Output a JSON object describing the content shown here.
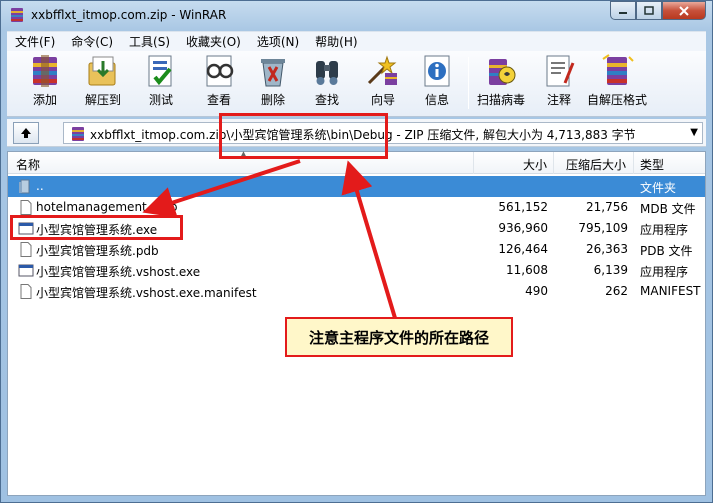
{
  "window": {
    "title": "xxbfflxt_itmop.com.zip - WinRAR"
  },
  "menu": [
    "文件(F)",
    "命令(C)",
    "工具(S)",
    "收藏夹(O)",
    "选项(N)",
    "帮助(H)"
  ],
  "toolbar": {
    "buttons": [
      {
        "label": "添加",
        "icon": "add-archive-icon"
      },
      {
        "label": "解压到",
        "icon": "extract-to-icon"
      },
      {
        "label": "测试",
        "icon": "test-icon"
      },
      {
        "label": "查看",
        "icon": "view-icon"
      },
      {
        "label": "删除",
        "icon": "delete-icon"
      },
      {
        "label": "查找",
        "icon": "find-icon"
      },
      {
        "label": "向导",
        "icon": "wizard-icon"
      },
      {
        "label": "信息",
        "icon": "info-icon"
      },
      {
        "label": "扫描病毒",
        "icon": "virus-scan-icon"
      },
      {
        "label": "注释",
        "icon": "comment-icon"
      },
      {
        "label": "自解压格式",
        "icon": "sfx-icon"
      }
    ]
  },
  "address": {
    "path_prefix": "xxbfflxt_itmop.com.zip\\小型宾馆管理系统\\bin\\Debug",
    "path_suffix": " - ZIP 压缩文件, 解包大小为 4,713,883 字节"
  },
  "columns": {
    "name": "名称",
    "size": "大小",
    "packed": "压缩后大小",
    "type": "类型"
  },
  "files": [
    {
      "name": "..",
      "size": "",
      "packed": "",
      "type": "文件夹",
      "icon": "folder-icon",
      "selected": true
    },
    {
      "name": "hotelmanagement.mdb",
      "size": "561,152",
      "packed": "21,756",
      "type": "MDB 文件",
      "icon": "file-icon",
      "selected": false
    },
    {
      "name": "小型宾馆管理系统.exe",
      "size": "936,960",
      "packed": "795,109",
      "type": "应用程序",
      "icon": "exe-icon",
      "selected": false
    },
    {
      "name": "小型宾馆管理系统.pdb",
      "size": "126,464",
      "packed": "26,363",
      "type": "PDB 文件",
      "icon": "file-icon",
      "selected": false
    },
    {
      "name": "小型宾馆管理系统.vshost.exe",
      "size": "11,608",
      "packed": "6,139",
      "type": "应用程序",
      "icon": "exe-icon",
      "selected": false
    },
    {
      "name": "小型宾馆管理系统.vshost.exe.manifest",
      "size": "490",
      "packed": "262",
      "type": "MANIFEST",
      "icon": "file-icon",
      "selected": false
    }
  ],
  "annotation": {
    "callout_text": "注意主程序文件的所在路径",
    "color": "#e31b1b"
  }
}
